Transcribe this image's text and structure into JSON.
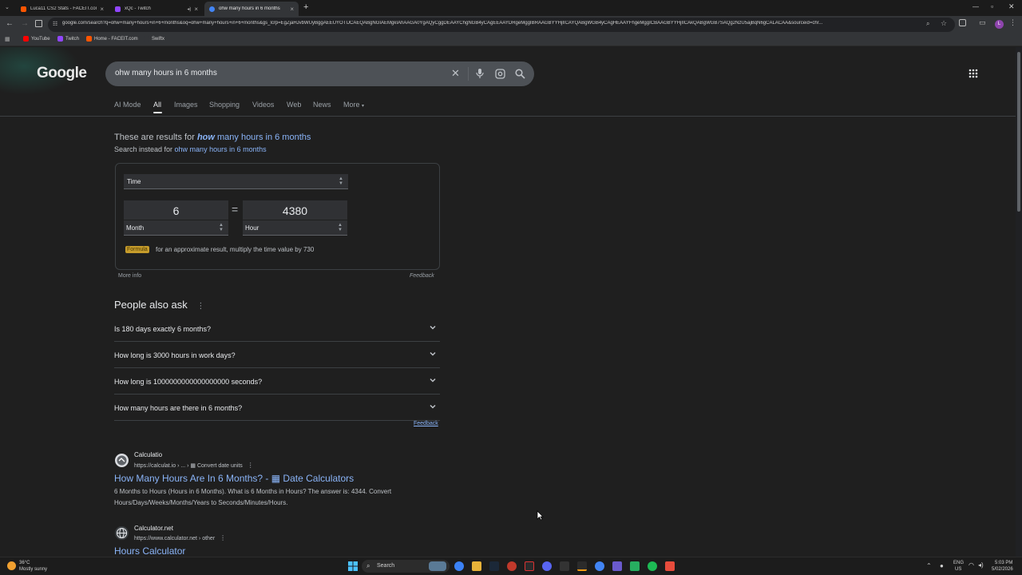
{
  "browser": {
    "tabs": [
      {
        "title": "Luca11 CS2 Stats - FACEIT.com",
        "color": "#ff5500",
        "active": false
      },
      {
        "title": "xQc - Twitch",
        "color": "#9146ff",
        "active": false
      },
      {
        "title": "ohw many hours in 6 months",
        "color": "#4285f4",
        "active": true
      }
    ],
    "url": "google.com/search?q=ohw+many+hours+in+6+months&oq=ohw+many+hours+in+6+months&gs_lcrp=EgZjaHJvbWUyBggAEEUYOTIJCAEQABgNGIAEMgkIAhAAGA0YgAQyCggDEAAYChgNGB4yCAgEEAAYDRgeMggIBRAAGBYYHjIICAYQABgWGB4yCAgHEAAYFhgeMggICBAAGBYYHjIICAkQABgWGB7SAQg2NzU5ajBqN6gCALACAA&sourceid=chr...",
    "bookmarks": [
      {
        "label": "YouTube",
        "color": "#ff0000"
      },
      {
        "label": "Twitch",
        "color": "#9146ff"
      },
      {
        "label": "Home - FACEIT.com",
        "color": "#ff5500"
      },
      {
        "label": "Swiftx",
        "color": "#333538"
      }
    ],
    "profile_initial": "L"
  },
  "search": {
    "logo": "Google",
    "query": "ohw many hours in 6 months",
    "nav": [
      "AI Mode",
      "All",
      "Images",
      "Shopping",
      "Videos",
      "Web",
      "News",
      "More"
    ],
    "nav_active": "All"
  },
  "spelling": {
    "prefix": "These are results for ",
    "corrected_word": "how",
    "corrected_rest": " many hours in 6 months",
    "instead_prefix": "Search instead for ",
    "original": "ohw many hours in 6 months"
  },
  "converter": {
    "category": "Time",
    "from_value": "6",
    "from_unit": "Month",
    "equals": "=",
    "to_value": "4380",
    "to_unit": "Hour",
    "formula_tag": "Formula",
    "formula_text": "for an approximate result, multiply the time value by 730",
    "more_info": "More info",
    "feedback": "Feedback"
  },
  "paa": {
    "title": "People also ask",
    "questions": [
      "Is 180 days exactly 6 months?",
      "How long is 3000 hours in work days?",
      "How long is 1000000000000000000 seconds?",
      "How many hours are there in 6 months?"
    ],
    "feedback": "Feedback"
  },
  "results": [
    {
      "site": "Calculatio",
      "url": "https://calculat.io › ... › ▦ Convert date units",
      "title": "How Many Hours Are In 6 Months? - ▦ Date Calculators",
      "snippet": "6 Months to Hours (Hours in 6 Months). What is 6 Months in Hours? The answer is: 4344. Convert Hours/Days/Weeks/Months/Years to Seconds/Minutes/Hours."
    },
    {
      "site": "Calculator.net",
      "url": "https://www.calculator.net › other",
      "title": "Hours Calculator",
      "snippet": ""
    }
  ],
  "taskbar": {
    "weather_temp": "36°C",
    "weather_desc": "Mostly sunny",
    "search_label": "Search",
    "lang1": "ENG",
    "lang2": "US",
    "time": "5:03 PM",
    "date": "5/02/2026"
  }
}
